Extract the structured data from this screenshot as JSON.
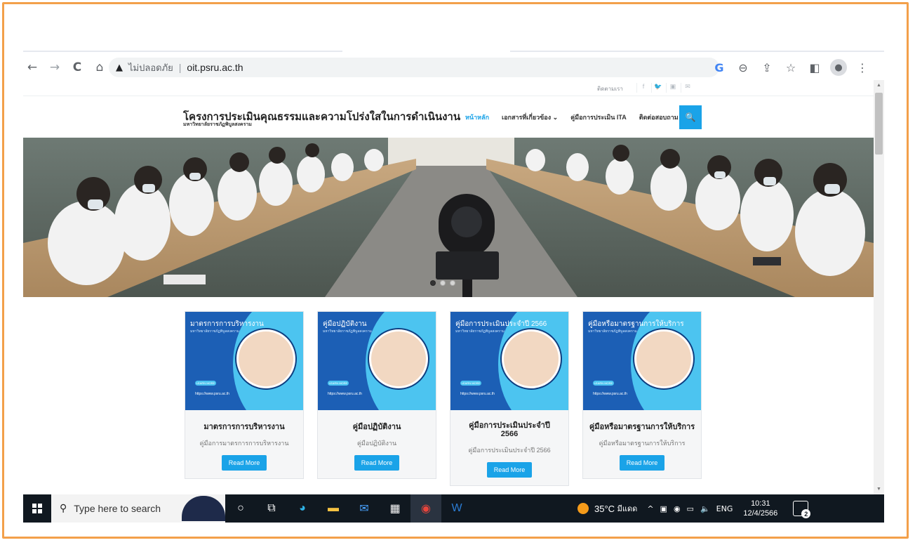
{
  "browser": {
    "insecure_label": "ไม่ปลอดภัย",
    "url": "oit.psru.ac.th",
    "back_icon": "←",
    "forward_icon": "→",
    "reload_icon": "C",
    "home_icon": "⌂",
    "warn_icon": "▲",
    "g_icon": "G",
    "zoom_icon": "⊖",
    "share_icon": "⇪",
    "star_icon": "☆",
    "sidepanel_icon": "◧",
    "profile_icon": "●",
    "menu_icon": "⋮"
  },
  "site": {
    "topbar_contact": "ติดตามเรา",
    "social": [
      "f",
      "🐦",
      "▣",
      "✉"
    ],
    "title": "โครงการประเมินคุณธรรมและความโปร่งใสในการดำเนินงาน",
    "subtitle": "มหาวิทยาลัยราชภัฏพิบูลสงคราม",
    "nav": [
      "หน้าหลัก",
      "เอกสารที่เกี่ยวข้อง ⌄",
      "คู่มือการประเมิน ITA",
      "ติดต่อสอบถาม"
    ],
    "search_icon": "🔍",
    "accent": "#1aa3e8"
  },
  "cards": [
    {
      "thumb_title": "มาตรการการบริหารงาน",
      "name": "มาตรการการบริหารงาน",
      "desc": "คู่มือการมาตรการการบริหารงาน",
      "button": "Read More"
    },
    {
      "thumb_title": "คู่มือปฏิบัติงาน",
      "name": "คู่มือปฏิบัติงาน",
      "desc": "คู่มือปฏิบัติงาน",
      "button": "Read More"
    },
    {
      "thumb_title": "คู่มือการประเมินประจำปี 2566",
      "name": "คู่มือการประเมินประจำปี 2566",
      "desc": "คู่มือการประเมินประจำปี 2566",
      "button": "Read More"
    },
    {
      "thumb_title": "คู่มือหรือมาตรฐานการให้บริการ",
      "name": "คู่มือหรือมาตรฐานการให้บริการ",
      "desc": "คู่มือหรือมาตรฐานการให้บริการ",
      "button": "Read More"
    }
  ],
  "thumb_common": {
    "subtitle": "มหาวิทยาลัยราชภัฏพิบูลสงคราม",
    "learn": "LEARN MORE",
    "web": "https://www.psru.ac.th"
  },
  "taskbar": {
    "search_placeholder": "Type here to search",
    "temperature": "35°C",
    "weather": "มีแดด",
    "lang": "ENG",
    "time": "10:31",
    "date": "12/4/2566",
    "notif_count": "2",
    "tray_up": "^",
    "tray_wifi": "◉",
    "tray_sound": "🔈"
  }
}
